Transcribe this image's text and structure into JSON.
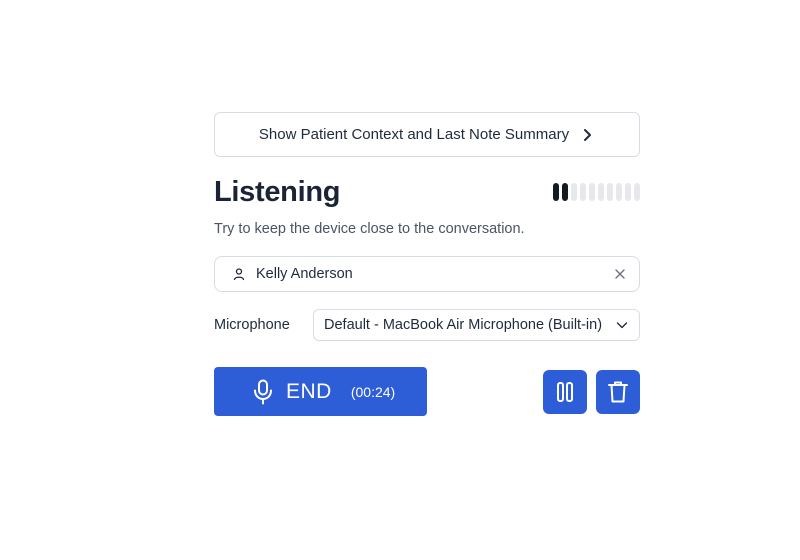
{
  "context_button": {
    "label": "Show Patient Context and Last Note Summary",
    "icon": "chevron-right-icon"
  },
  "status": {
    "title": "Listening",
    "audio_level": {
      "active_bars": 2,
      "total_bars": 10
    }
  },
  "hint": "Try to keep the device close to the conversation.",
  "patient": {
    "name": "Kelly Anderson",
    "icon": "user-icon",
    "clear_icon": "close-icon"
  },
  "microphone": {
    "label": "Microphone",
    "selected": "Default - MacBook Air Microphone (Built-in)"
  },
  "actions": {
    "end_label": "END",
    "timer": "(00:24)",
    "pause_icon": "pause-icon",
    "delete_icon": "trash-icon"
  },
  "colors": {
    "primary": "#2d5ed8",
    "meter_active": "#141a26",
    "meter_inactive": "#e6e8ec",
    "border": "#d9dde3"
  }
}
